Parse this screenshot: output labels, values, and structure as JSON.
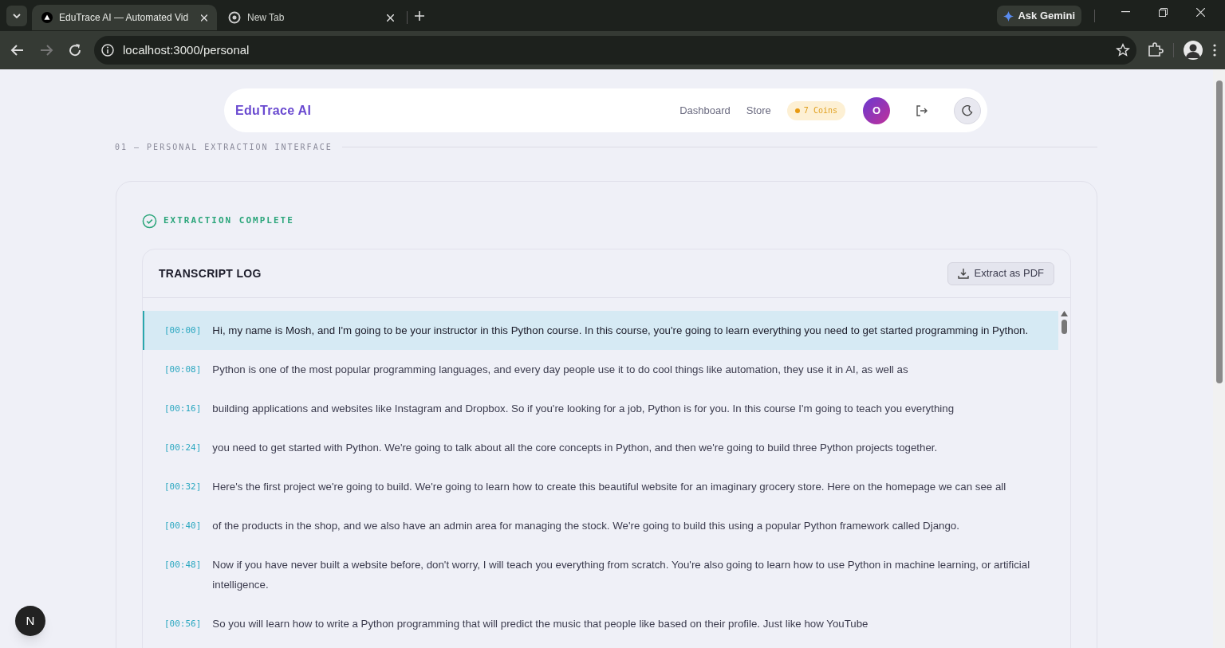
{
  "browser": {
    "tabs": [
      {
        "title": "EduTrace AI — Automated Vid",
        "selected": true
      },
      {
        "title": "New Tab",
        "selected": false
      }
    ],
    "ask_button": "Ask Gemini",
    "url": "localhost:3000/personal"
  },
  "nav": {
    "brand": "EduTrace AI",
    "links": [
      "Dashboard",
      "Store"
    ],
    "coins": "7 Coins",
    "avatar_letter": "O"
  },
  "section_label": "01 — PERSONAL EXTRACTION INTERFACE",
  "status": "EXTRACTION COMPLETE",
  "transcript": {
    "title": "TRANSCRIPT LOG",
    "export_button": "Extract as PDF",
    "rows": [
      {
        "time": "[00:00]",
        "text": "Hi, my name is Mosh, and I'm going to be your instructor in this Python course. In this course, you're going to learn everything you need to get started programming in Python.",
        "selected": true
      },
      {
        "time": "[00:08]",
        "text": "Python is one of the most popular programming languages, and every day people use it to do cool things like automation, they use it in AI, as well as",
        "selected": false
      },
      {
        "time": "[00:16]",
        "text": "building applications and websites like Instagram and Dropbox. So if you're looking for a job, Python is for you. In this course I'm going to teach you everything",
        "selected": false
      },
      {
        "time": "[00:24]",
        "text": "you need to get started with Python. We're going to talk about all the core concepts in Python, and then we're going to build three Python projects together.",
        "selected": false
      },
      {
        "time": "[00:32]",
        "text": "Here's the first project we're going to build. We're going to learn how to create this beautiful website for an imaginary grocery store. Here on the homepage we can see all",
        "selected": false
      },
      {
        "time": "[00:40]",
        "text": "of the products in the shop, and we also have an admin area for managing the stock. We're going to build this using a popular Python framework called Django.",
        "selected": false
      },
      {
        "time": "[00:48]",
        "text": "Now if you have never built a website before, don't worry, I will teach you everything from scratch. You're also going to learn how to use Python in machine learning, or artificial intelligence.",
        "selected": false
      },
      {
        "time": "[00:56]",
        "text": "So you will learn how to write a Python programming that will predict the music that people like based on their profile. Just like how YouTube",
        "selected": false
      }
    ]
  },
  "dev_badge": "N"
}
